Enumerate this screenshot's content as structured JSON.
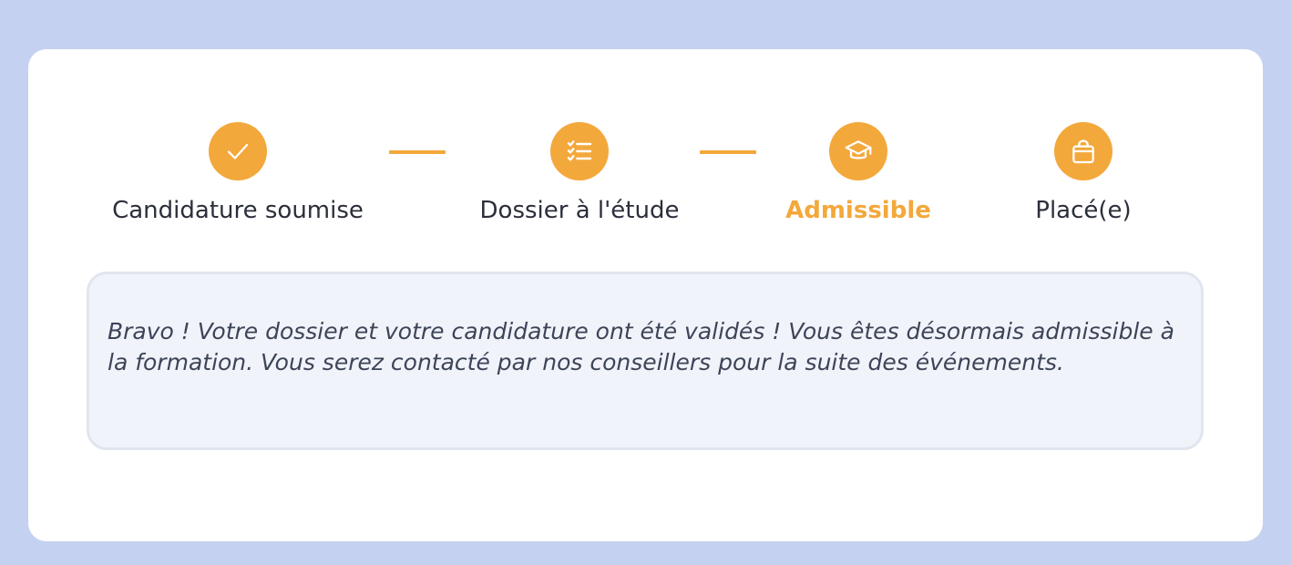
{
  "accent_color": "#f3a83b",
  "steps": [
    {
      "label": "Candidature soumise",
      "icon": "check-icon",
      "state": "done"
    },
    {
      "label": "Dossier à l'étude",
      "icon": "checklist-icon",
      "state": "done"
    },
    {
      "label": "Admissible",
      "icon": "graduation-cap-icon",
      "state": "current"
    },
    {
      "label": "Placé(e)",
      "icon": "shopping-bag-icon",
      "state": "upcoming"
    }
  ],
  "message": "Bravo ! Votre dossier et votre candidature ont été validés ! Vous êtes désormais admissible à la formation. Vous serez contacté par nos conseillers pour la suite des événements."
}
